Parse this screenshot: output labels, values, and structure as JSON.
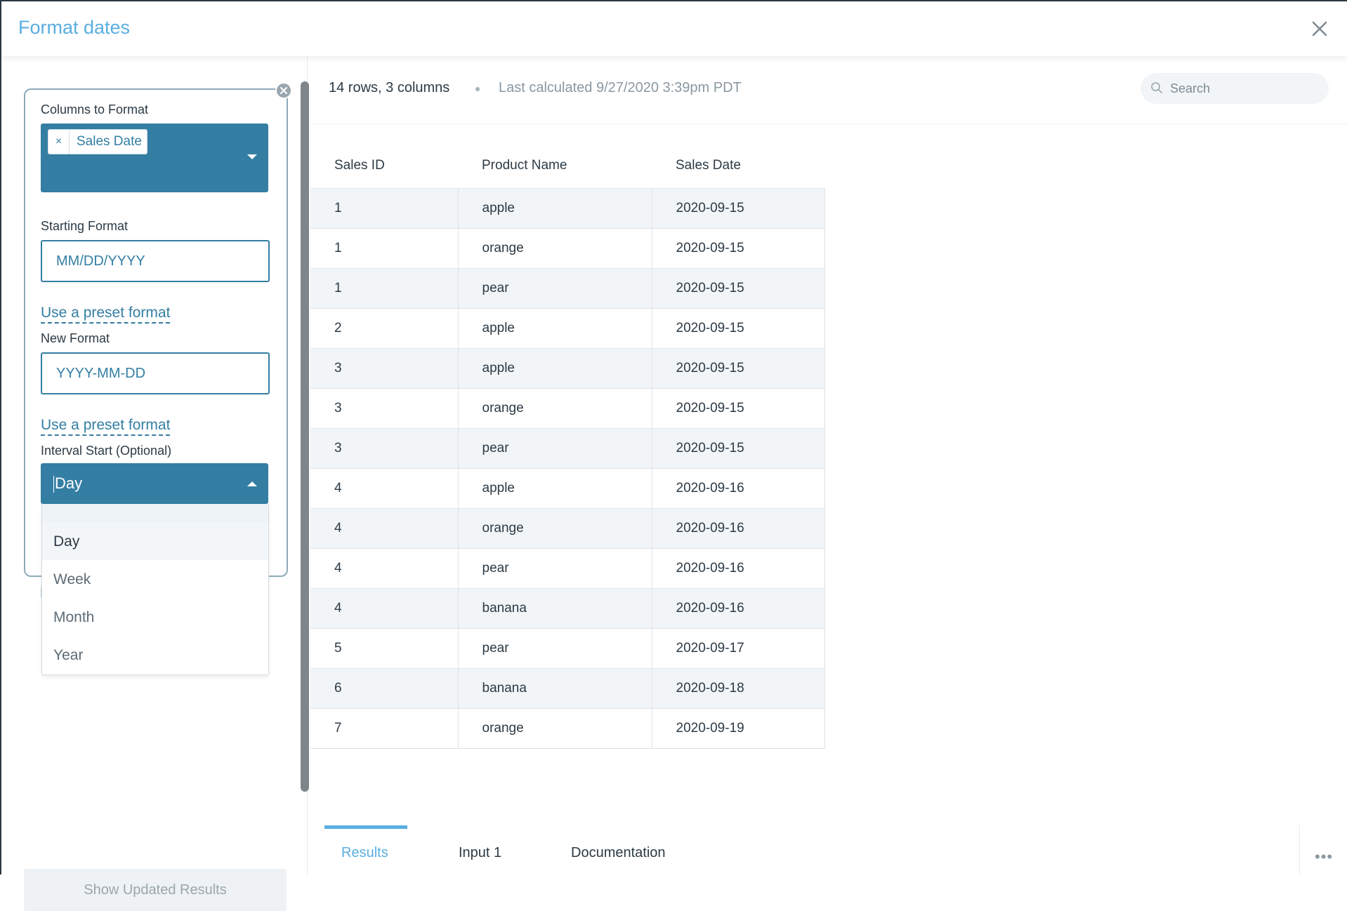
{
  "header": {
    "title": "Format dates"
  },
  "left": {
    "columns_label": "Columns to Format",
    "selected_columns": [
      "Sales Date"
    ],
    "chip_remove": "×",
    "starting_format_label": "Starting Format",
    "starting_format_value": "MM/DD/YYYY",
    "preset_link_1": "Use a preset format",
    "new_format_label": "New Format",
    "new_format_value": "YYYY-MM-DD",
    "preset_link_2": "Use a preset format",
    "interval_label": "Interval Start (Optional)",
    "interval_value": "Day",
    "interval_options": [
      "Day",
      "Week",
      "Month",
      "Year"
    ],
    "show_button": "Show Updated Results"
  },
  "right": {
    "stats": "14 rows, 3 columns",
    "last_calculated": "Last calculated 9/27/2020 3:39pm PDT",
    "search_placeholder": "Search",
    "columns": [
      "Sales ID",
      "Product Name",
      "Sales Date"
    ],
    "rows": [
      [
        "1",
        "apple",
        "2020-09-15"
      ],
      [
        "1",
        "orange",
        "2020-09-15"
      ],
      [
        "1",
        "pear",
        "2020-09-15"
      ],
      [
        "2",
        "apple",
        "2020-09-15"
      ],
      [
        "3",
        "apple",
        "2020-09-15"
      ],
      [
        "3",
        "orange",
        "2020-09-15"
      ],
      [
        "3",
        "pear",
        "2020-09-15"
      ],
      [
        "4",
        "apple",
        "2020-09-16"
      ],
      [
        "4",
        "orange",
        "2020-09-16"
      ],
      [
        "4",
        "pear",
        "2020-09-16"
      ],
      [
        "4",
        "banana",
        "2020-09-16"
      ],
      [
        "5",
        "pear",
        "2020-09-17"
      ],
      [
        "6",
        "banana",
        "2020-09-18"
      ],
      [
        "7",
        "orange",
        "2020-09-19"
      ]
    ]
  },
  "tabs": {
    "items": [
      "Results",
      "Input 1",
      "Documentation"
    ],
    "active": "Results",
    "more": "•••"
  }
}
